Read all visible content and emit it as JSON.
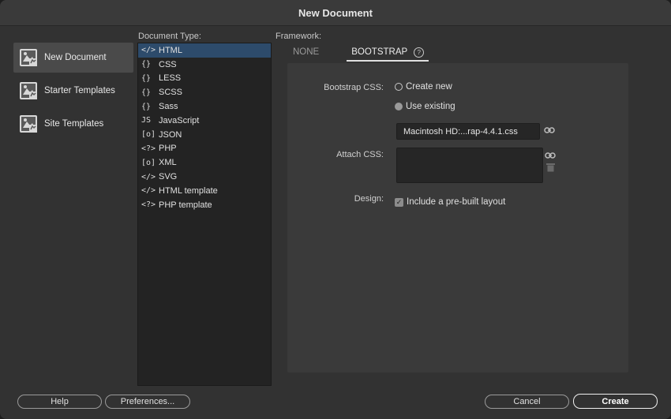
{
  "window": {
    "title": "New Document"
  },
  "categories": [
    {
      "label": "New Document",
      "selected": true
    },
    {
      "label": "Starter Templates",
      "selected": false
    },
    {
      "label": "Site Templates",
      "selected": false
    }
  ],
  "document_type": {
    "label": "Document Type:",
    "items": [
      {
        "glyph": "</>",
        "label": "HTML",
        "selected": true
      },
      {
        "glyph": "{}",
        "label": "CSS"
      },
      {
        "glyph": "{}",
        "label": "LESS"
      },
      {
        "glyph": "{}",
        "label": "SCSS"
      },
      {
        "glyph": "{}",
        "label": "Sass"
      },
      {
        "glyph": "JS",
        "label": "JavaScript"
      },
      {
        "glyph": "[o]",
        "label": "JSON"
      },
      {
        "glyph": "<?>",
        "label": "PHP"
      },
      {
        "glyph": "[o]",
        "label": "XML"
      },
      {
        "glyph": "</>",
        "label": "SVG"
      },
      {
        "glyph": "</>",
        "label": "HTML template"
      },
      {
        "glyph": "<?>",
        "label": "PHP template"
      }
    ]
  },
  "framework": {
    "label": "Framework:",
    "tabs": [
      {
        "label": "NONE",
        "active": false
      },
      {
        "label": "BOOTSTRAP",
        "active": true
      }
    ],
    "help_icon": "?"
  },
  "bootstrap": {
    "css_label": "Bootstrap CSS:",
    "create_new": "Create new",
    "use_existing": "Use existing",
    "selected_option": "use_existing",
    "path_value": "Macintosh HD:...rap-4.4.1.css",
    "attach_label": "Attach CSS:",
    "design_label": "Design:",
    "prebuilt_label": "Include a pre-built layout",
    "prebuilt_checked": true
  },
  "buttons": {
    "help": "Help",
    "preferences": "Preferences...",
    "cancel": "Cancel",
    "create": "Create"
  },
  "icons": {
    "category": "template-icon",
    "link": "link-icon",
    "trash": "trash-icon",
    "check": "checkmark-icon"
  },
  "colors": {
    "selection": "#2d4b6b",
    "panel": "#3a3a3a",
    "window": "#323232"
  }
}
